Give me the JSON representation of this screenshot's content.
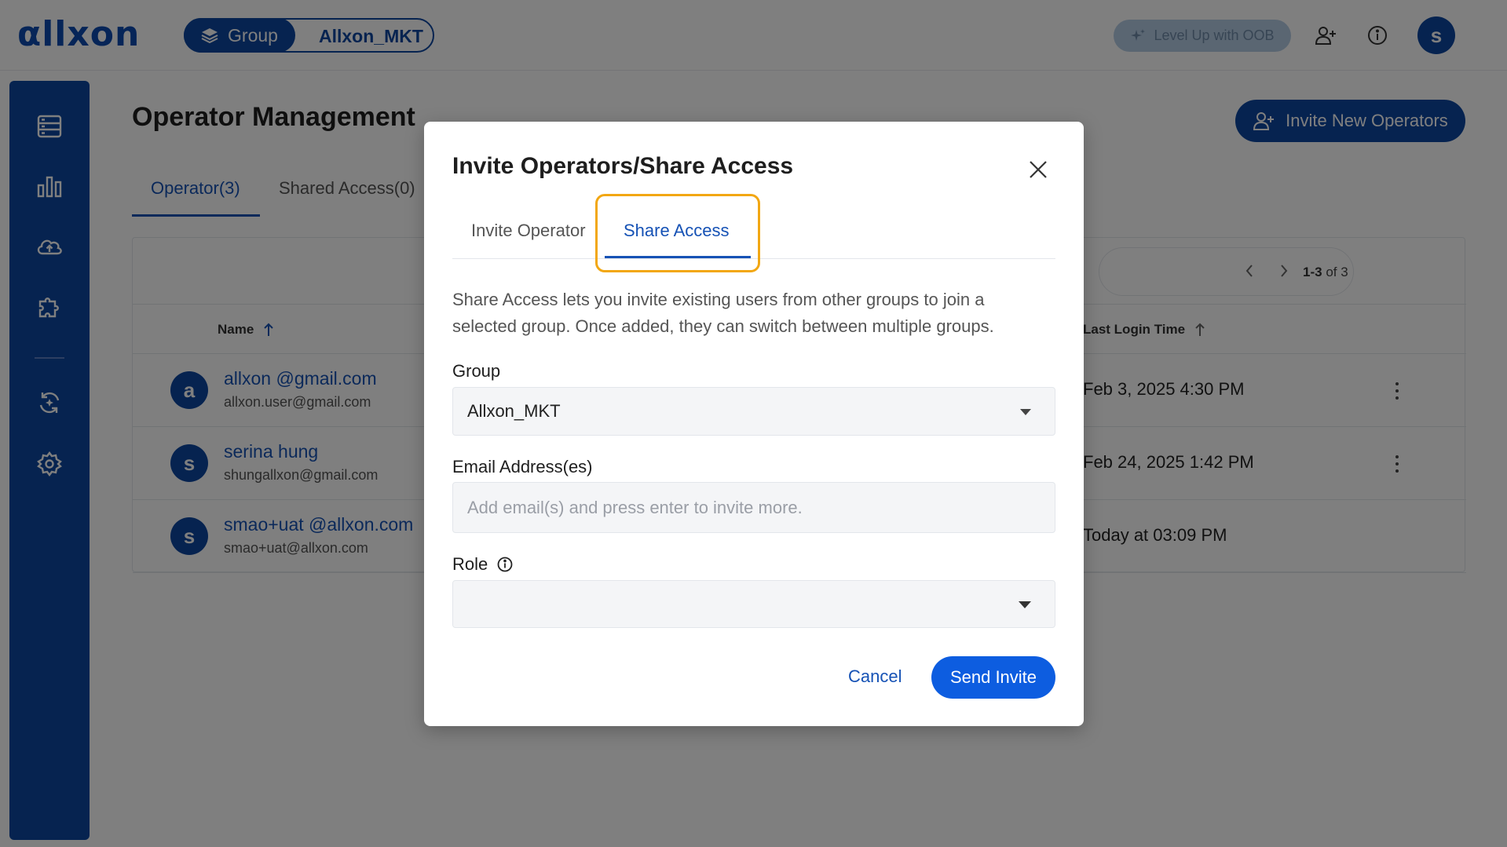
{
  "topbar": {
    "logo": "αllxon",
    "group_label": "Group",
    "group_name": "Allxon_MKT",
    "oob_label": "Level Up with OOB",
    "avatar_letter": "s",
    "icons": [
      "add-user-icon",
      "info-icon"
    ]
  },
  "sidebar": {
    "icons": [
      "devices-icon",
      "chart-icon",
      "cloud-icon",
      "plugin-icon",
      "sync-icon",
      "settings-icon"
    ]
  },
  "page": {
    "title": "Operator Management",
    "invite_new_label": "Invite New Operators",
    "tabs": [
      {
        "label": "Operator(3)",
        "active": true
      },
      {
        "label": "Shared Access(0)",
        "active": false
      }
    ]
  },
  "table": {
    "pagination": {
      "range": "1-3",
      "of_label": "of 3"
    },
    "headers": {
      "name": "Name",
      "last_login": "Last Login Time"
    },
    "rows": [
      {
        "avatar": "a",
        "name": "allxon @gmail.com",
        "email": "allxon.user@gmail.com",
        "last_login": "Feb 3, 2025 4:30 PM",
        "has_menu": true
      },
      {
        "avatar": "s",
        "name": "serina hung",
        "email": "shungallxon@gmail.com",
        "last_login": "Feb 24, 2025 1:42 PM",
        "has_menu": true
      },
      {
        "avatar": "s",
        "name": "smao+uat @allxon.com",
        "email": "smao+uat@allxon.com",
        "last_login": "Today at 03:09 PM",
        "has_menu": false
      }
    ]
  },
  "modal": {
    "title": "Invite Operators/Share Access",
    "tabs": [
      {
        "label": "Invite Operator",
        "active": false
      },
      {
        "label": "Share Access",
        "active": true
      }
    ],
    "description": "Share Access lets you invite existing users from other groups to join a selected group. Once added, they can switch between multiple groups.",
    "group_label": "Group",
    "group_value": "Allxon_MKT",
    "email_label": "Email Address(es)",
    "email_placeholder": "Add email(s) and press enter to invite more.",
    "email_value": "",
    "role_label": "Role",
    "role_value": "",
    "cancel_label": "Cancel",
    "send_label": "Send Invite"
  },
  "colors": {
    "brand": "#0d47a1",
    "primary_button": "#0d5de0",
    "highlight": "#f2a713",
    "link": "#1652b5"
  }
}
